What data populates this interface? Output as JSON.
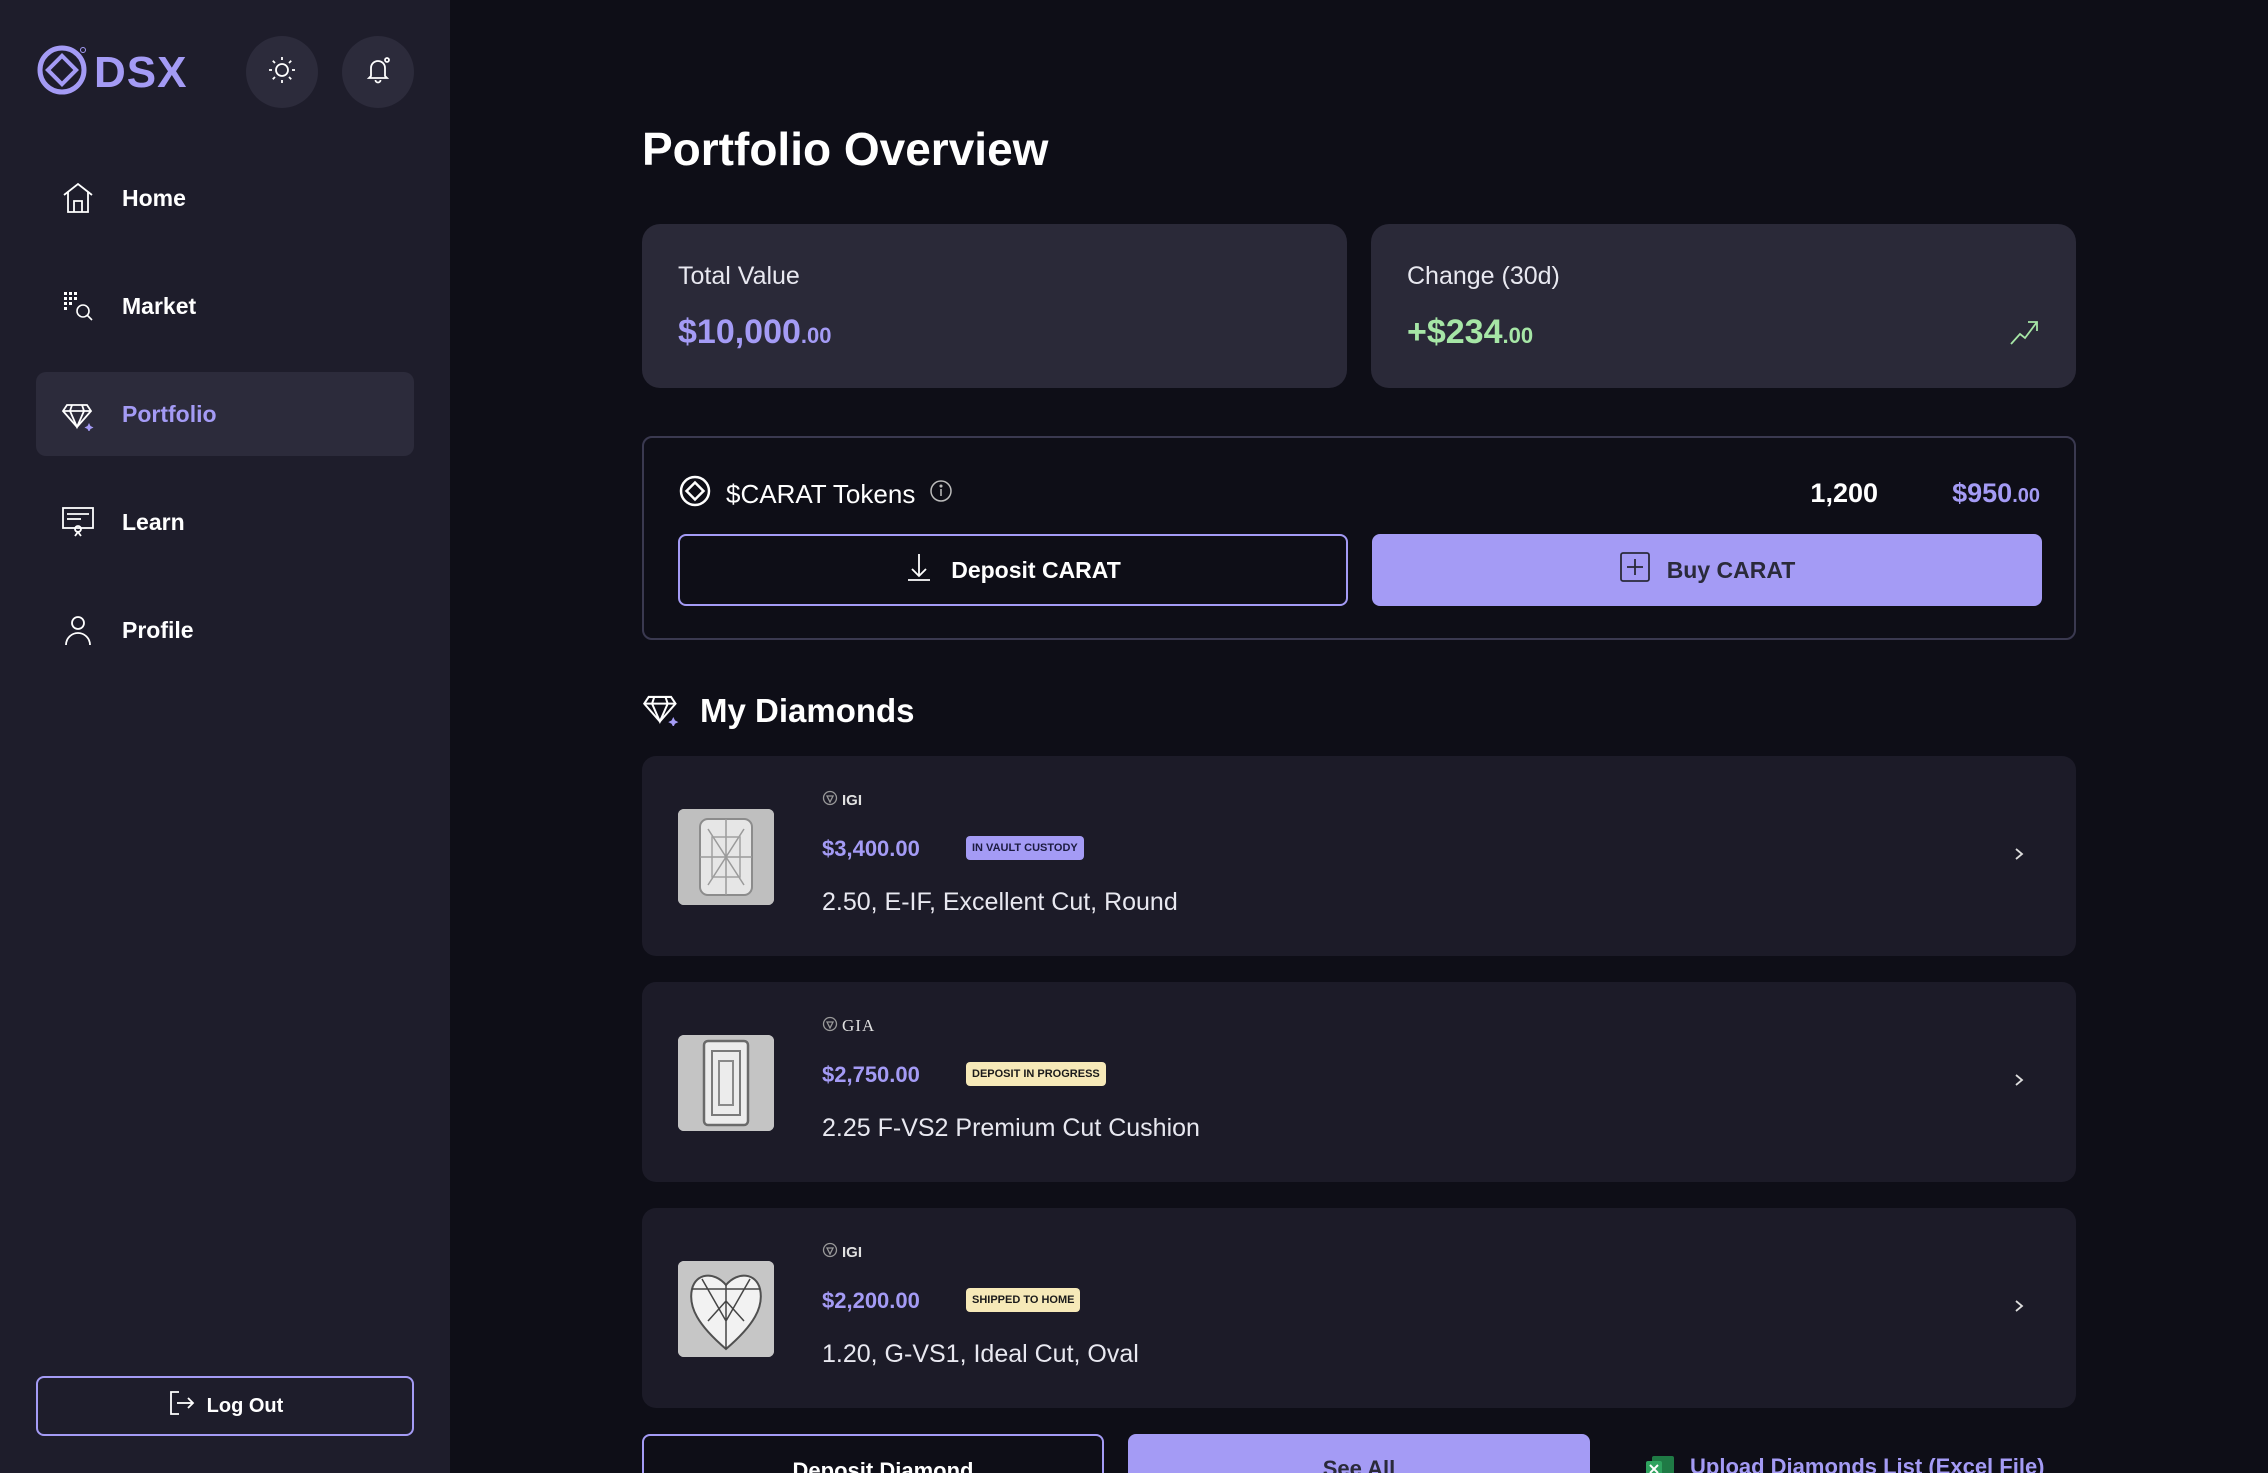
{
  "brand": {
    "name": "DSX",
    "accent": "#a49bf5"
  },
  "header": {
    "theme_icon": "sun-icon",
    "notifications_icon": "bell-icon"
  },
  "sidebar": {
    "items": [
      {
        "label": "Home",
        "icon": "home-icon"
      },
      {
        "label": "Market",
        "icon": "market-search-icon"
      },
      {
        "label": "Portfolio",
        "icon": "diamond-icon",
        "active": true
      },
      {
        "label": "Learn",
        "icon": "presentation-icon"
      },
      {
        "label": "Profile",
        "icon": "user-icon"
      }
    ],
    "logout_label": "Log Out"
  },
  "main": {
    "title": "Portfolio Overview",
    "total_value": {
      "label": "Total Value",
      "amount": "$10,000",
      "cents": ".00"
    },
    "change": {
      "label": "Change (30d)",
      "amount": "+$234",
      "cents": ".00"
    },
    "tokens": {
      "label": "$CARAT Tokens",
      "quantity": "1,200",
      "value": "$950",
      "cents": ".00",
      "deposit_label": "Deposit CARAT",
      "buy_label": "Buy CARAT"
    },
    "diamonds_heading": "My Diamonds",
    "diamonds": [
      {
        "cert": "IGI",
        "price": "$3,400.00",
        "status": "IN VAULT CUSTODY",
        "description": "2.50, E-IF, Excellent Cut, Round"
      },
      {
        "cert": "GIA",
        "price": "$2,750.00",
        "status": "DEPOSIT IN PROGRESS",
        "description": "2.25 F-VS2 Premium Cut Cushion"
      },
      {
        "cert": "IGI",
        "price": "$2,200.00",
        "status": "SHIPPED TO HOME",
        "description": "1.20, G-VS1, Ideal Cut, Oval"
      }
    ],
    "actions": {
      "deposit_diamond": "Deposit Diamond",
      "see_all": "See All",
      "upload": "Upload Diamonds List (Excel File)"
    }
  }
}
